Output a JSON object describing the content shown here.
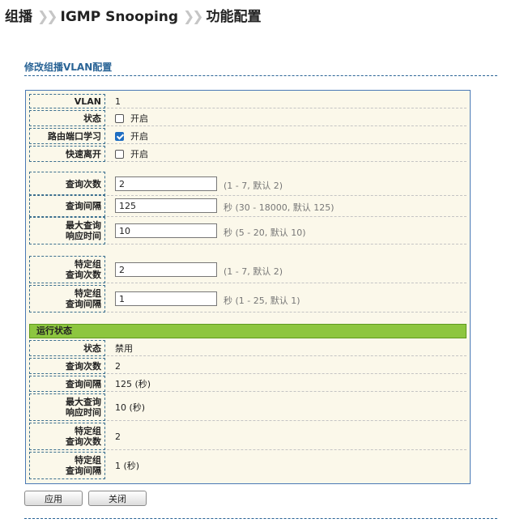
{
  "breadcrumb": {
    "level1": "组播",
    "sep": "»",
    "level2": "IGMP Snooping",
    "level3": "功能配置"
  },
  "section_title": "修改组播VLAN配置",
  "config": {
    "vlan": {
      "label": "VLAN",
      "value": "1"
    },
    "state": {
      "label": "状态",
      "option": "开启",
      "checked": false
    },
    "router_port_learning": {
      "label": "路由端口学习",
      "option": "开启",
      "checked": true
    },
    "fast_leave": {
      "label": "快速离开",
      "option": "开启",
      "checked": false
    },
    "query_count": {
      "label": "查询次数",
      "value": "2",
      "hint": "(1 - 7, 默认 2)"
    },
    "query_interval": {
      "label": "查询间隔",
      "value": "125",
      "hint": "秒 (30 - 18000, 默认 125)"
    },
    "max_response": {
      "label_line1": "最大查询",
      "label_line2": "响应时间",
      "value": "10",
      "hint": "秒 (5 - 20, 默认 10)"
    },
    "group_query_count": {
      "label_line1": "特定组",
      "label_line2": "查询次数",
      "value": "2",
      "hint": "(1 - 7, 默认 2)"
    },
    "group_query_interval": {
      "label_line1": "特定组",
      "label_line2": "查询间隔",
      "value": "1",
      "hint": "秒 (1 - 25, 默认 1)"
    }
  },
  "running_status": {
    "header": "运行状态",
    "state": {
      "label": "状态",
      "value": "禁用"
    },
    "query_count": {
      "label": "查询次数",
      "value": "2"
    },
    "query_interval": {
      "label": "查询间隔",
      "value": "125 (秒)"
    },
    "max_response": {
      "label_line1": "最大查询",
      "label_line2": "响应时间",
      "value": "10 (秒)"
    },
    "group_query_count": {
      "label_line1": "特定组",
      "label_line2": "查询次数",
      "value": "2"
    },
    "group_query_interval": {
      "label_line1": "特定组",
      "label_line2": "查询间隔",
      "value": "1 (秒)"
    }
  },
  "buttons": {
    "apply": "应用",
    "close": "关闭"
  },
  "colors": {
    "accent": "#2a6496",
    "status_bar": "#8dc63f",
    "panel_bg": "#fbf8ea",
    "checkbox_checked": "#1f6ec2"
  }
}
